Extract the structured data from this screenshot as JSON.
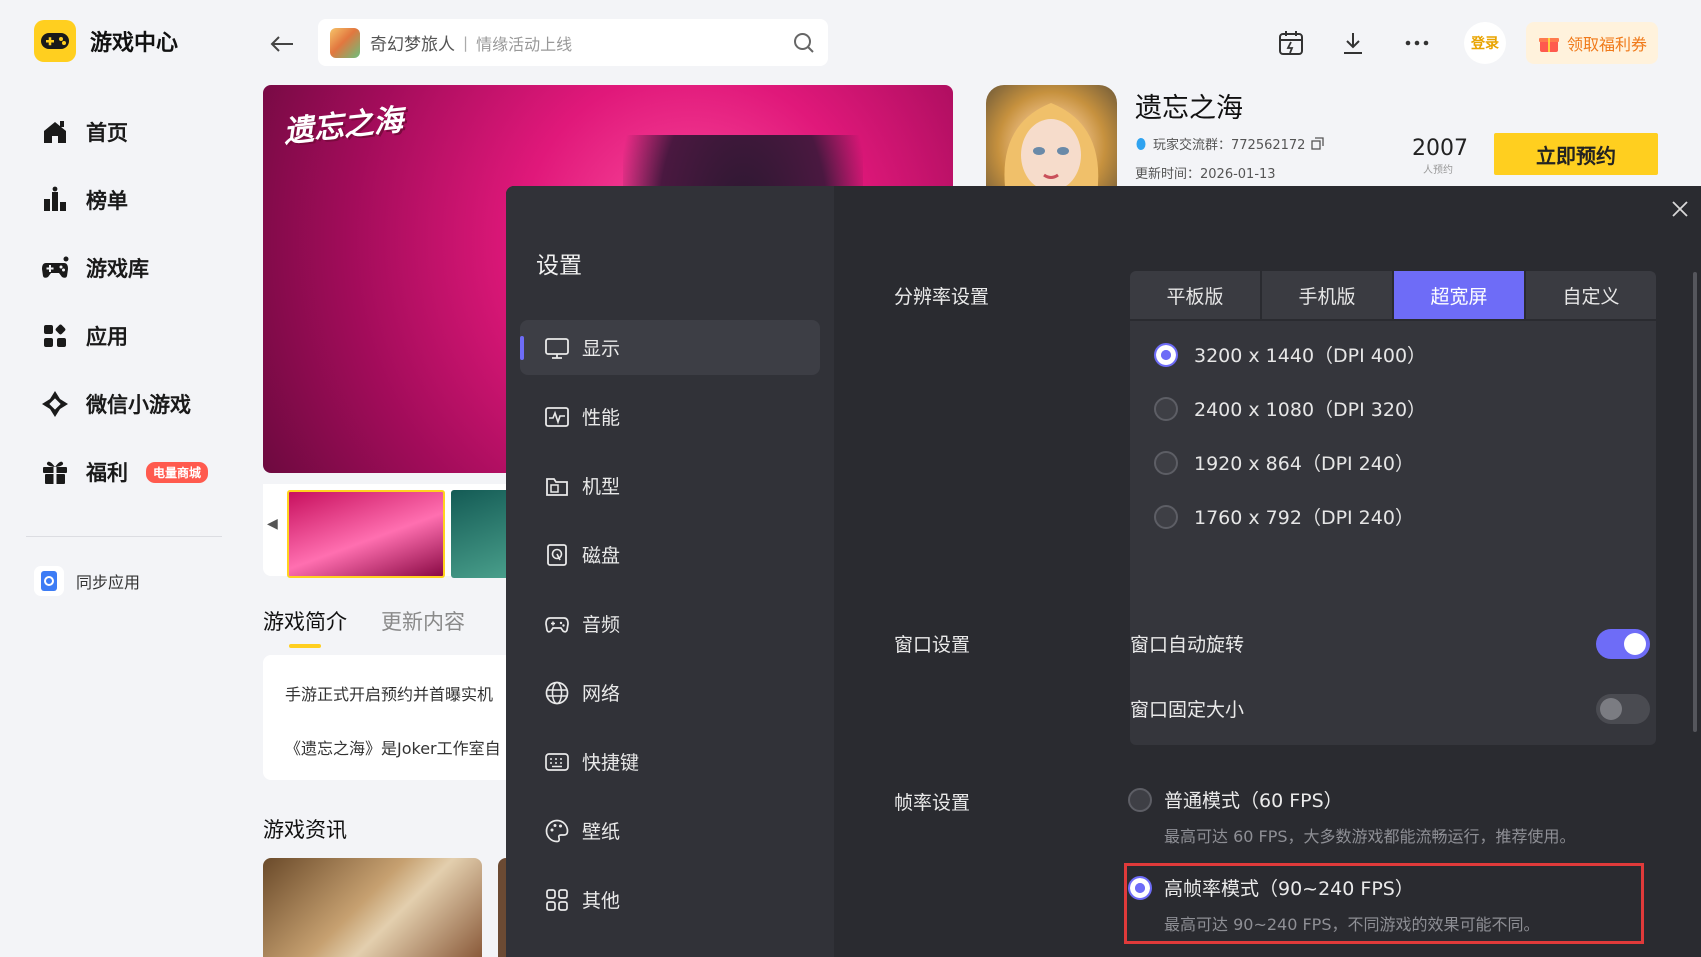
{
  "app": {
    "brand_title": "游戏中心",
    "colors": {
      "accent": "#ffcf1f",
      "modal_accent": "#6e6cf7",
      "badge_red": "#ff5a4e",
      "highlight_red": "#e03a3a"
    }
  },
  "sidebar": {
    "items": [
      {
        "label": "首页",
        "icon": "home-icon"
      },
      {
        "label": "榜单",
        "icon": "ranking-icon"
      },
      {
        "label": "游戏库",
        "icon": "gamepad-icon"
      },
      {
        "label": "应用",
        "icon": "apps-icon"
      },
      {
        "label": "微信小游戏",
        "icon": "minigame-icon"
      },
      {
        "label": "福利",
        "icon": "gift-icon",
        "badge": "电量商城"
      }
    ],
    "sync_label": "同步应用"
  },
  "topbar": {
    "search_text": "奇幻梦旅人",
    "search_sep": "|",
    "search_hint": "情缘活动上线",
    "login_label": "登录",
    "welfare_label": "领取福利券"
  },
  "game": {
    "hero_logo": "遗忘之海",
    "title": "遗忘之海",
    "group_label": "玩家交流群：772562172",
    "update_label": "更新时间：2026-01-13",
    "reserve_count": "2007",
    "reserve_count_label": "人预约",
    "reserve_button": "立即预约"
  },
  "content": {
    "tabs": [
      "游戏简介",
      "更新内容"
    ],
    "intro_lines": [
      "手游正式开启预约并首曝实机",
      "《遗忘之海》是Joker工作室自"
    ],
    "news_title": "游戏资讯"
  },
  "settings": {
    "title": "设置",
    "nav": [
      {
        "label": "显示",
        "icon": "monitor-icon",
        "active": true
      },
      {
        "label": "性能",
        "icon": "performance-icon",
        "active": false
      },
      {
        "label": "机型",
        "icon": "device-model-icon",
        "active": false
      },
      {
        "label": "磁盘",
        "icon": "disk-icon",
        "active": false
      },
      {
        "label": "音频",
        "icon": "audio-gamepad-icon",
        "active": false
      },
      {
        "label": "网络",
        "icon": "globe-icon",
        "active": false
      },
      {
        "label": "快捷键",
        "icon": "keyboard-icon",
        "active": false
      },
      {
        "label": "壁纸",
        "icon": "palette-icon",
        "active": false
      },
      {
        "label": "其他",
        "icon": "grid-icon",
        "active": false
      }
    ],
    "resolution": {
      "label": "分辨率设置",
      "tabs": [
        "平板版",
        "手机版",
        "超宽屏",
        "自定义"
      ],
      "active_tab": "超宽屏",
      "options": [
        {
          "label": "3200 x 1440（DPI 400）",
          "selected": true
        },
        {
          "label": "2400 x 1080（DPI 320）",
          "selected": false
        },
        {
          "label": "1920 x 864（DPI 240）",
          "selected": false
        },
        {
          "label": "1760 x 792（DPI 240）",
          "selected": false
        }
      ]
    },
    "window": {
      "label": "窗口设置",
      "auto_rotate": {
        "label": "窗口自动旋转",
        "on": true
      },
      "fixed_size": {
        "label": "窗口固定大小",
        "on": false
      }
    },
    "framerate": {
      "label": "帧率设置",
      "options": [
        {
          "title": "普通模式（60 FPS）",
          "desc": "最高可达 60 FPS，大多数游戏都能流畅运行，推荐使用。",
          "selected": false
        },
        {
          "title": "高帧率模式（90~240 FPS）",
          "desc": "最高可达 90~240 FPS，不同游戏的效果可能不同。",
          "selected": true
        }
      ]
    }
  }
}
